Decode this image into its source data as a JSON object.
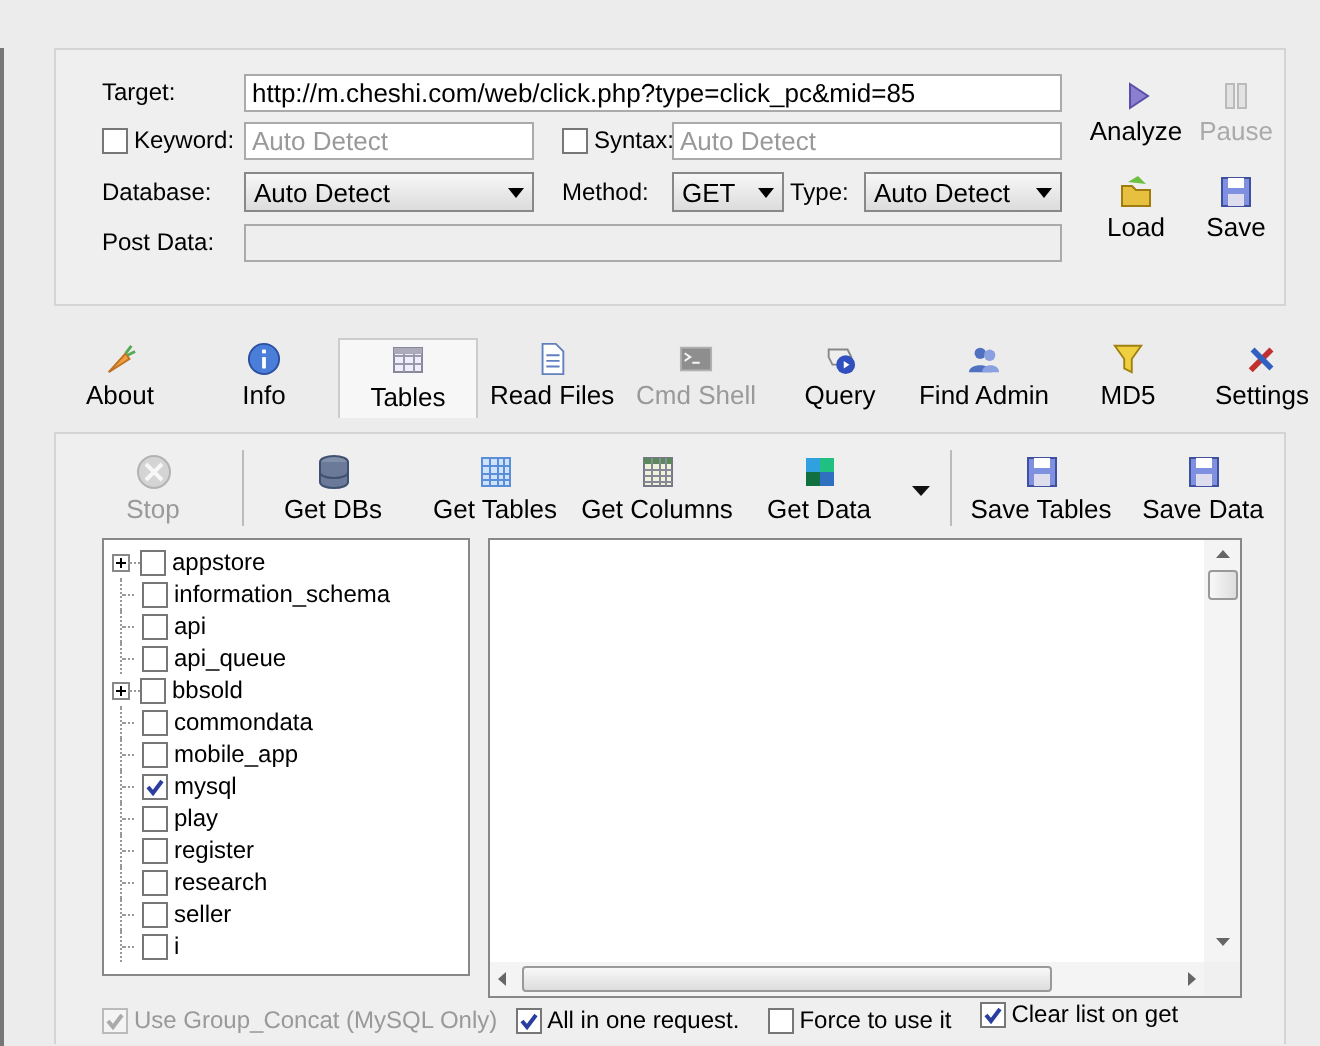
{
  "form": {
    "target": {
      "label": "Target:",
      "value": "http://m.cheshi.com/web/click.php?type=click_pc&mid=85"
    },
    "keyword": {
      "label": "Keyword:",
      "checked": false,
      "placeholder": "Auto Detect"
    },
    "syntax": {
      "label": "Syntax:",
      "checked": false,
      "placeholder": "Auto Detect"
    },
    "database": {
      "label": "Database:",
      "value": "Auto Detect"
    },
    "method": {
      "label": "Method:",
      "value": "GET"
    },
    "type": {
      "label": "Type:",
      "value": "Auto Detect"
    },
    "post_data": {
      "label": "Post Data:",
      "disabled": true
    }
  },
  "side_buttons": [
    {
      "label": "Analyze",
      "kind": "play",
      "disabled": false
    },
    {
      "label": "Pause",
      "kind": "pause",
      "disabled": true
    },
    {
      "label": "Load",
      "kind": "folder",
      "disabled": false
    },
    {
      "label": "Save",
      "kind": "floppy",
      "disabled": false
    }
  ],
  "tabs": [
    {
      "label": "About",
      "kind": "carrot",
      "selected": false,
      "disabled": false
    },
    {
      "label": "Info",
      "kind": "info",
      "selected": false,
      "disabled": false
    },
    {
      "label": "Tables",
      "kind": "table",
      "selected": true,
      "disabled": false
    },
    {
      "label": "Read Files",
      "kind": "document",
      "selected": false,
      "disabled": false
    },
    {
      "label": "Cmd Shell",
      "kind": "terminal",
      "selected": false,
      "disabled": true
    },
    {
      "label": "Query",
      "kind": "query",
      "selected": false,
      "disabled": false
    },
    {
      "label": "Find Admin",
      "kind": "users",
      "selected": false,
      "disabled": false
    },
    {
      "label": "MD5",
      "kind": "funnel",
      "selected": false,
      "disabled": false
    },
    {
      "label": "Settings",
      "kind": "tools",
      "selected": false,
      "disabled": false
    }
  ],
  "toolbar": [
    {
      "kind": "stop",
      "label": "Stop",
      "disabled": true
    },
    {
      "kind": "separator"
    },
    {
      "kind": "database",
      "label": "Get DBs",
      "disabled": false
    },
    {
      "kind": "grid",
      "label": "Get Tables",
      "disabled": false
    },
    {
      "kind": "columns",
      "label": "Get Columns",
      "disabled": false
    },
    {
      "kind": "data",
      "label": "Get Data",
      "disabled": false
    },
    {
      "kind": "dropdown"
    },
    {
      "kind": "separator"
    },
    {
      "kind": "floppy",
      "label": "Save Tables",
      "disabled": false
    },
    {
      "kind": "floppy",
      "label": "Save Data",
      "disabled": false
    }
  ],
  "tree": [
    {
      "label": "appstore",
      "checked": false,
      "expandable": true
    },
    {
      "label": "information_schema",
      "checked": false,
      "expandable": false
    },
    {
      "label": "api",
      "checked": false,
      "expandable": false
    },
    {
      "label": "api_queue",
      "checked": false,
      "expandable": false
    },
    {
      "label": "bbsold",
      "checked": false,
      "expandable": true
    },
    {
      "label": "commondata",
      "checked": false,
      "expandable": false
    },
    {
      "label": "mobile_app",
      "checked": false,
      "expandable": false
    },
    {
      "label": "mysql",
      "checked": true,
      "expandable": false
    },
    {
      "label": "play",
      "checked": false,
      "expandable": false
    },
    {
      "label": "register",
      "checked": false,
      "expandable": false
    },
    {
      "label": "research",
      "checked": false,
      "expandable": false
    },
    {
      "label": "seller",
      "checked": false,
      "expandable": false
    },
    {
      "label": "i",
      "checked": false,
      "expandable": false
    }
  ],
  "options": [
    {
      "label": "Use Group_Concat (MySQL Only)",
      "checked": true,
      "disabled": true
    },
    {
      "label": "All in one request.",
      "checked": true,
      "disabled": false
    },
    {
      "label": "Force to use it",
      "checked": false,
      "disabled": false
    },
    {
      "label": "Clear list on get",
      "checked": true,
      "disabled": false
    }
  ]
}
